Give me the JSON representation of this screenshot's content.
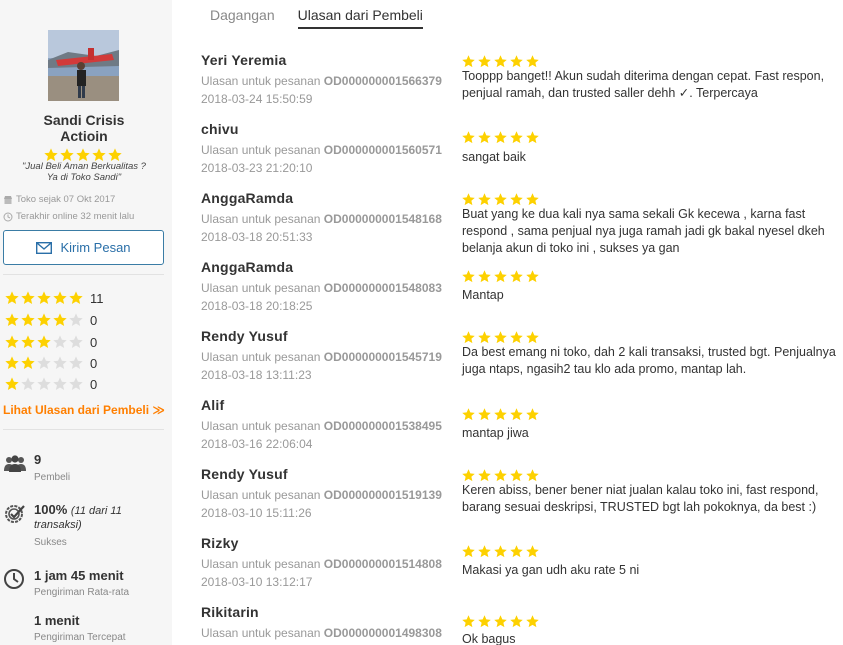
{
  "tabs": [
    {
      "label": "Dagangan",
      "active": false
    },
    {
      "label": "Ulasan dari Pembeli",
      "active": true
    }
  ],
  "shop": {
    "name_line1": "Sandi Crisis",
    "name_line2": "Actioin",
    "stars": 5,
    "tagline_line1": "\"Jual Beli Aman Berkualitas ?",
    "tagline_line2": "Ya di Toko Sandi\"",
    "since": "Toko sejak 07 Okt 2017",
    "last_online": "Terakhir online 32 menit lalu",
    "message_button": "Kirim Pesan"
  },
  "rating_breakdown": [
    {
      "stars": 5,
      "count": "11"
    },
    {
      "stars": 4,
      "count": "0"
    },
    {
      "stars": 3,
      "count": "0"
    },
    {
      "stars": 2,
      "count": "0"
    },
    {
      "stars": 1,
      "count": "0"
    }
  ],
  "see_all_link": "Lihat Ulasan dari Pembeli ≫",
  "stats": {
    "buyers": {
      "value": "9",
      "label": "Pembeli"
    },
    "success": {
      "value": "100%",
      "value_detail_1": "(11 dari 11",
      "value_detail_2": "transaksi)",
      "label": "Sukses"
    },
    "avg_shipping": {
      "value": "1 jam 45 menit",
      "label": "Pengiriman Rata-rata"
    },
    "fastest_shipping": {
      "value": "1 menit",
      "label": "Pengiriman Tercepat"
    }
  },
  "order_prefix": "Ulasan untuk pesanan",
  "colors": {
    "star": "#fdd100",
    "star_empty": "#dddddd",
    "link_orange": "#ff7f00",
    "button_blue": "#2a6fa8"
  },
  "reviews": [
    {
      "name": "Yeri Yeremia",
      "order_id": "OD000000001566379",
      "date": "2018-03-24 15:50:59",
      "stars": 5,
      "text": "Tooppp banget!! Akun sudah diterima dengan cepat. Fast respon, penjual ramah, dan trusted saller dehh ✓. Terpercaya"
    },
    {
      "name": "chivu",
      "order_id": "OD000000001560571",
      "date": "2018-03-23 21:20:10",
      "stars": 5,
      "text": "sangat baik"
    },
    {
      "name": "AnggaRamda",
      "order_id": "OD000000001548168",
      "date": "2018-03-18 20:51:33",
      "stars": 5,
      "text": "Buat yang ke dua kali nya sama sekali Gk kecewa , karna fast respond , sama penjual nya juga ramah jadi gk bakal nyesel dkeh belanja akun di toko ini , sukses ya gan"
    },
    {
      "name": "AnggaRamda",
      "order_id": "OD000000001548083",
      "date": "2018-03-18 20:18:25",
      "stars": 5,
      "text": "Mantap"
    },
    {
      "name": "Rendy Yusuf",
      "order_id": "OD000000001545719",
      "date": "2018-03-18 13:11:23",
      "stars": 5,
      "text": "Da best emang ni toko, dah 2 kali transaksi, trusted bgt. Penjualnya juga ntaps, ngasih2 tau klo ada promo, mantap lah."
    },
    {
      "name": "Alif",
      "order_id": "OD000000001538495",
      "date": "2018-03-16 22:06:04",
      "stars": 5,
      "text": "mantap jiwa"
    },
    {
      "name": "Rendy Yusuf",
      "order_id": "OD000000001519139",
      "date": "2018-03-10 15:11:26",
      "stars": 5,
      "text": "Keren abiss, bener bener niat jualan kalau toko ini, fast respond, barang sesuai deskripsi, TRUSTED bgt lah pokoknya, da best :)"
    },
    {
      "name": "Rizky",
      "order_id": "OD000000001514808",
      "date": "2018-03-10 13:12:17",
      "stars": 5,
      "text": "Makasi ya gan udh aku rate 5 ni"
    },
    {
      "name": "Rikitarin",
      "order_id": "OD000000001498308",
      "date": "",
      "stars": 5,
      "text": "Ok bagus"
    }
  ]
}
